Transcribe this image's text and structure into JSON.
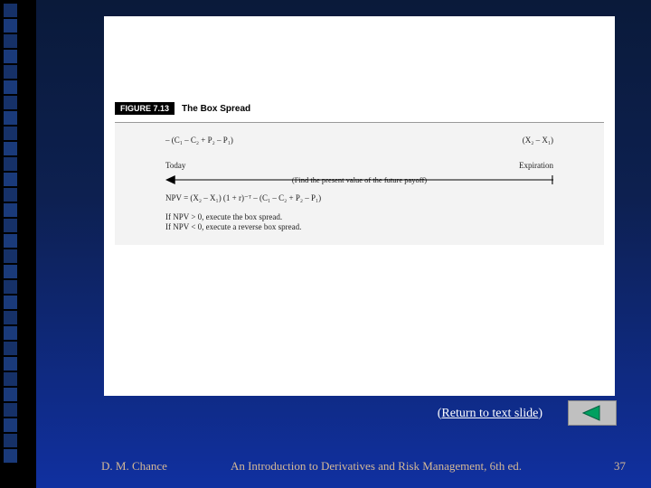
{
  "figure": {
    "badge": "FIGURE 7.13",
    "title": "The Box Spread",
    "left_expr": "– (C₁ – C₂ + P₂ – P₁)",
    "right_expr": "(X₂ – X₁)",
    "today_label": "Today",
    "expiration_label": "Expiration",
    "pv_text": "(Find the present value of the future payoff)",
    "npv": "NPV = (X₂ – X₁) (1 + r)⁻ᵀ – (C₁ – C₂ + P₂ – P₁)",
    "cond1": "If NPV > 0, execute the box spread.",
    "cond2": "If NPV < 0, execute a reverse box spread."
  },
  "return_link_prefix": "(",
  "return_link_text": "Return to text slide",
  "return_link_suffix": ")",
  "footer": {
    "author": "D. M. Chance",
    "book": "An Introduction to Derivatives and Risk Management, 6th ed.",
    "page": "37"
  }
}
